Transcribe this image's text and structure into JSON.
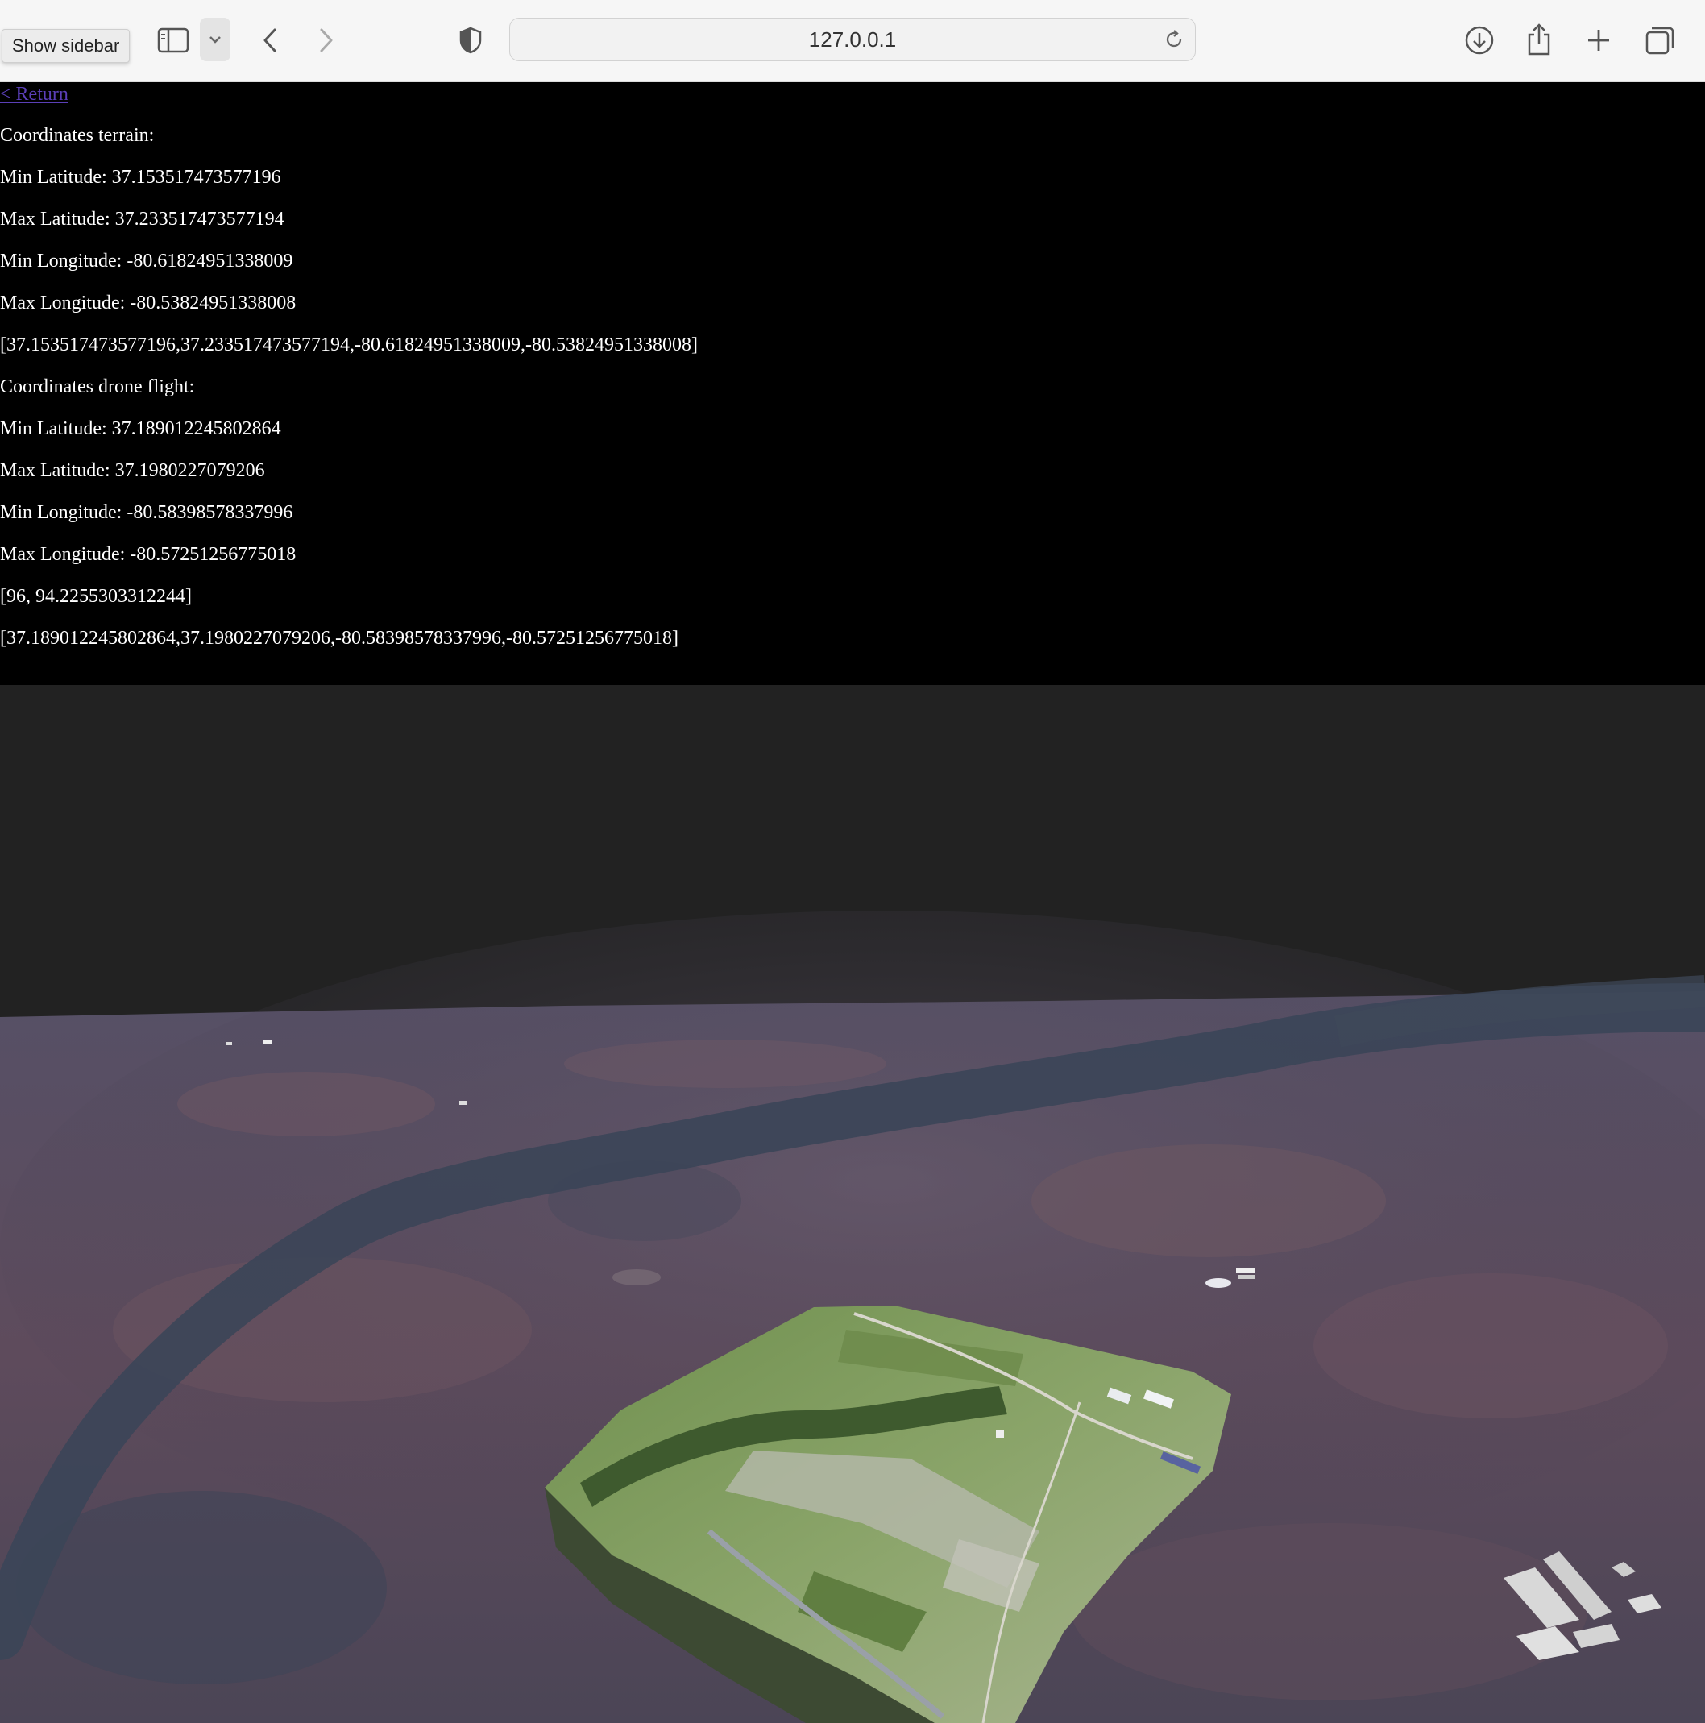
{
  "browser": {
    "tooltip": "Show sidebar",
    "url": "127.0.0.1",
    "icons": [
      "sidebar-icon",
      "chevron-down-icon",
      "back-icon",
      "forward-icon",
      "shield-icon",
      "reload-icon",
      "download-icon",
      "share-icon",
      "new-tab-icon",
      "tab-overview-icon"
    ]
  },
  "page": {
    "return_link": "< Return",
    "terrain": {
      "heading": "Coordinates terrain:",
      "min_lat": "Min Latitude: 37.153517473577196",
      "max_lat": "Max Latitude: 37.233517473577194",
      "min_lon": "Min Longitude: -80.61824951338009",
      "max_lon": "Max Longitude: -80.53824951338008",
      "array": "[37.153517473577196,37.233517473577194,-80.61824951338009,-80.53824951338008]"
    },
    "drone": {
      "heading": "Coordinates drone flight:",
      "min_lat": "Min Latitude: 37.189012245802864",
      "max_lat": "Max Latitude: 37.1980227079206",
      "min_lon": "Min Longitude: -80.58398578337996",
      "max_lon": "Max Longitude: -80.57251256775018",
      "size": "[96, 94.2255303312244]",
      "array": "[37.189012245802864,37.1980227079206,-80.58398578337996,-80.57251256775018]"
    }
  },
  "viewer": {
    "background_color": "#222222",
    "terrain_color": "#5a4c5e",
    "river_color": "#3a4356",
    "field_color": "#7f9a5c"
  }
}
